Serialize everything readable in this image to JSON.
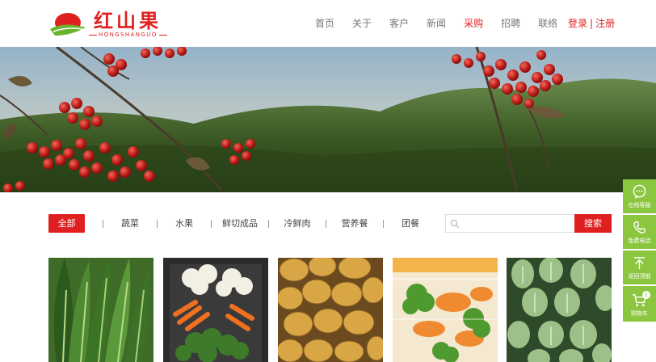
{
  "brand": {
    "name_cn": "红山果",
    "name_en": "HONGSHANGUO"
  },
  "nav": {
    "items": [
      {
        "label": "首页"
      },
      {
        "label": "关于"
      },
      {
        "label": "客户"
      },
      {
        "label": "新闻"
      },
      {
        "label": "采购",
        "active": true
      },
      {
        "label": "招聘"
      },
      {
        "label": "联络"
      }
    ],
    "login": "登录",
    "separator": "|",
    "register": "注册"
  },
  "categories": [
    {
      "label": "全部",
      "active": true
    },
    {
      "label": "蔬菜"
    },
    {
      "label": "水果"
    },
    {
      "label": "鲜切成品"
    },
    {
      "label": "冷鲜肉"
    },
    {
      "label": "营养餐"
    },
    {
      "label": "团餐"
    }
  ],
  "search": {
    "placeholder": "",
    "button": "搜索"
  },
  "side_toolbar": {
    "online_service": "在线客服",
    "free_call": "免费电话",
    "back_to_top": "返回顶部",
    "cart": "购物车",
    "cart_count": "1"
  },
  "colors": {
    "brand_red": "#e02020",
    "side_green": "#8cc63f"
  }
}
